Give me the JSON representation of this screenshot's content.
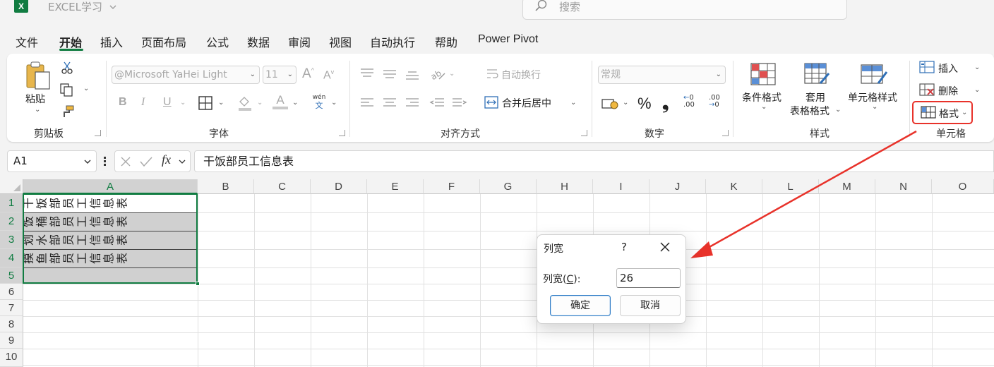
{
  "titlebar": {
    "app_icon": "X",
    "file_name": "EXCEL学习",
    "search_placeholder": "搜索"
  },
  "menu": {
    "tabs": [
      "文件",
      "开始",
      "插入",
      "页面布局",
      "公式",
      "数据",
      "审阅",
      "视图",
      "自动执行",
      "帮助",
      "Power Pivot"
    ],
    "active_tab": "开始"
  },
  "ribbon": {
    "clipboard": {
      "paste_label": "粘贴",
      "group_label": "剪贴板"
    },
    "font": {
      "font_name": "@Microsoft YaHei Light",
      "font_size": "11",
      "wen_label": "wén",
      "wen_char": "文",
      "bold": "B",
      "italic": "I",
      "underline": "U",
      "font_color_letter": "A",
      "grow_letter": "A",
      "shrink_letter": "A",
      "group_label": "字体"
    },
    "alignment": {
      "wrap_label": "自动换行",
      "merge_label": "合并后居中",
      "group_label": "对齐方式"
    },
    "number": {
      "format": "常规",
      "percent": "%",
      "comma": "❟",
      "inc_decimal": ".00",
      "dec_decimal": ".00",
      "group_label": "数字"
    },
    "styles": {
      "cond_format": "条件格式",
      "table_format_1": "套用",
      "table_format_2": "表格格式",
      "cell_styles": "单元格样式",
      "group_label": "样式"
    },
    "cells": {
      "insert": "插入",
      "delete": "删除",
      "format": "格式",
      "group_label": "单元格"
    },
    "accent_color": "#107c41",
    "highlight_color": "#e8322a"
  },
  "formula_bar": {
    "name_box": "A1",
    "fx_label": "fx",
    "content": "干饭部员工信息表"
  },
  "sheet": {
    "columns": [
      "A",
      "B",
      "C",
      "D",
      "E",
      "F",
      "G",
      "H",
      "I",
      "J",
      "K",
      "L",
      "M",
      "N",
      "O"
    ],
    "rows": [
      "1",
      "2",
      "3",
      "4",
      "5",
      "6",
      "7",
      "8",
      "9",
      "10"
    ],
    "cells_A": [
      "干饭部员工信息表",
      "饭桶部员工信息表",
      "划水部员工信息表",
      "摸鱼部员工信息表",
      ""
    ]
  },
  "dialog": {
    "title": "列宽",
    "help": "?",
    "label_prefix": "列宽(",
    "label_key": "C",
    "label_suffix": "):",
    "value": "26",
    "ok_label": "确定",
    "cancel_label": "取消"
  }
}
